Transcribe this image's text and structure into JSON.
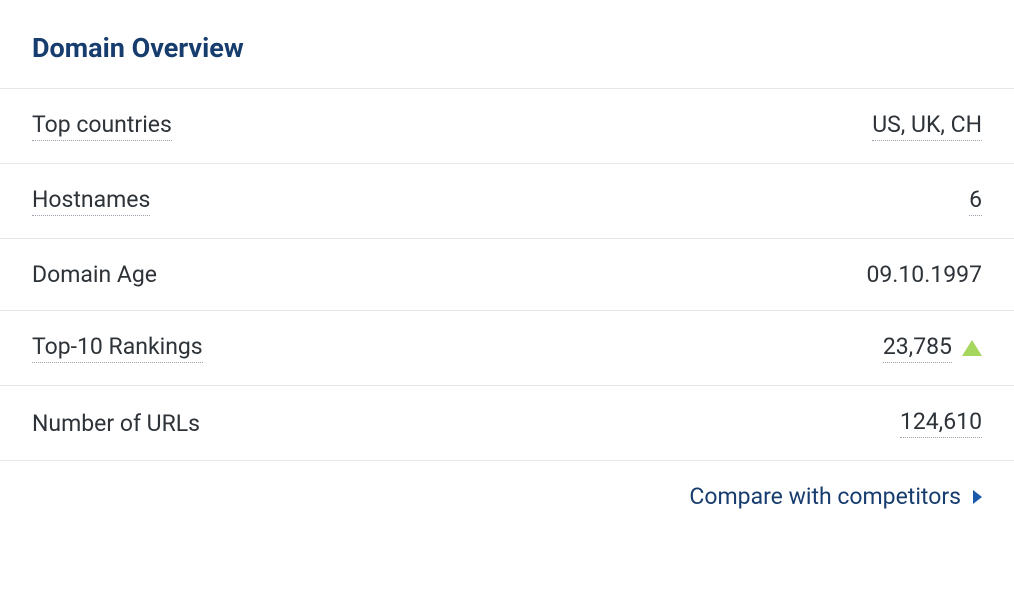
{
  "panel": {
    "title": "Domain Overview",
    "rows": [
      {
        "label": "Top countries",
        "value": "US, UK, CH",
        "labelDotted": true,
        "valueDotted": true,
        "hasTrendUp": false
      },
      {
        "label": "Hostnames",
        "value": "6",
        "labelDotted": true,
        "valueDotted": true,
        "hasTrendUp": false
      },
      {
        "label": "Domain Age",
        "value": "09.10.1997",
        "labelDotted": false,
        "valueDotted": false,
        "hasTrendUp": false
      },
      {
        "label": "Top-10 Rankings",
        "value": "23,785",
        "labelDotted": true,
        "valueDotted": true,
        "hasTrendUp": true
      },
      {
        "label": "Number of URLs",
        "value": "124,610",
        "labelDotted": false,
        "valueDotted": true,
        "hasTrendUp": false
      }
    ],
    "compareLink": "Compare with competitors"
  }
}
